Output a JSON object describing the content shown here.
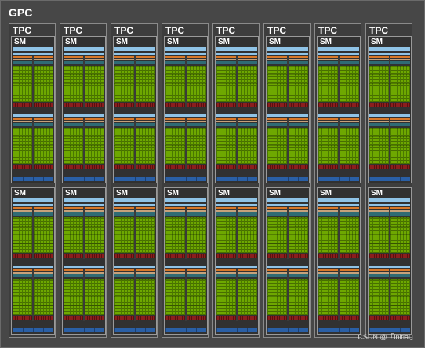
{
  "gpc": {
    "title": "GPC"
  },
  "tpc_count": 8,
  "tpc": {
    "title": "TPC"
  },
  "sm_per_tpc": 2,
  "sm": {
    "title": "SM"
  },
  "colors": {
    "background": "#474747",
    "l1_bar": "#8fc3e6",
    "scheduler_orange": "#d9792a",
    "scheduler_tan": "#c6a17b",
    "register_teal": "#2f6b74",
    "dispatch_blue": "#2a5fa5",
    "core_green": "#6ea800",
    "sfu_red": "#8b1e1e",
    "tex_blue": "#2a5fa5"
  },
  "watermark": "CSDN @「initial」"
}
